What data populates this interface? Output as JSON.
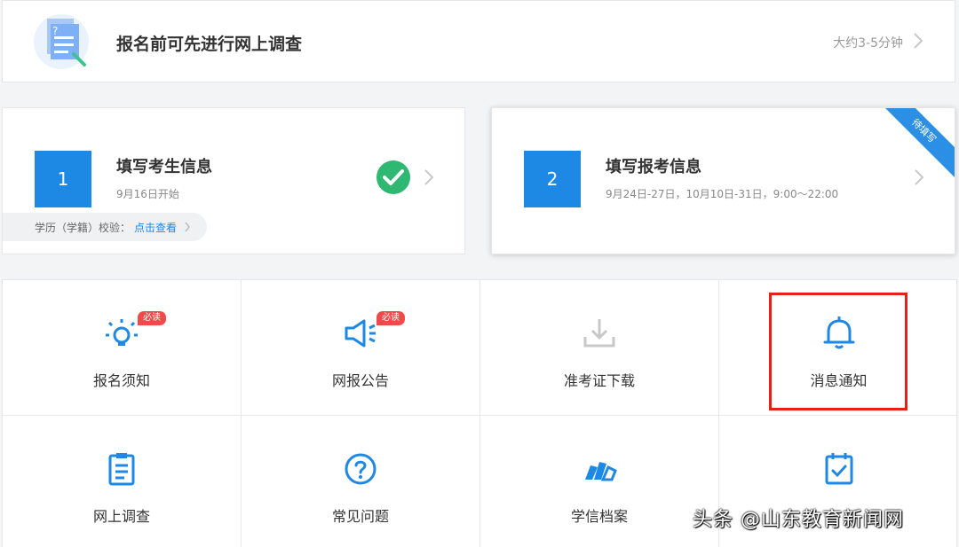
{
  "survey": {
    "title": "报名前可先进行网上调查",
    "time": "大约3-5分钟"
  },
  "steps": [
    {
      "number": "1",
      "title": "填写考生信息",
      "subtitle": "9月16日开始",
      "status": "completed",
      "verify_label": "学历（学籍）校验：",
      "verify_link": "点击查看"
    },
    {
      "number": "2",
      "title": "填写报考信息",
      "subtitle": "9月24日-27日，10月10日-31日，9:00～22:00",
      "ribbon": "待填写"
    }
  ],
  "grid": {
    "items": [
      {
        "label": "报名须知",
        "icon": "lightbulb-icon",
        "badge": "必读"
      },
      {
        "label": "网报公告",
        "icon": "megaphone-icon",
        "badge": "必读"
      },
      {
        "label": "准考证下载",
        "icon": "download-icon"
      },
      {
        "label": "消息通知",
        "icon": "bell-icon"
      },
      {
        "label": "网上调查",
        "icon": "clipboard-icon"
      },
      {
        "label": "常见问题",
        "icon": "question-circle-icon"
      },
      {
        "label": "学信档案",
        "icon": "archive-icon"
      },
      {
        "label": "",
        "icon": "checklist-icon"
      }
    ]
  },
  "watermark": "头条 @山东教育新闻网",
  "colors": {
    "accent": "#1e88e5",
    "badge": "#f24a4a",
    "success": "#2eb872",
    "highlight": "#e8201a"
  }
}
